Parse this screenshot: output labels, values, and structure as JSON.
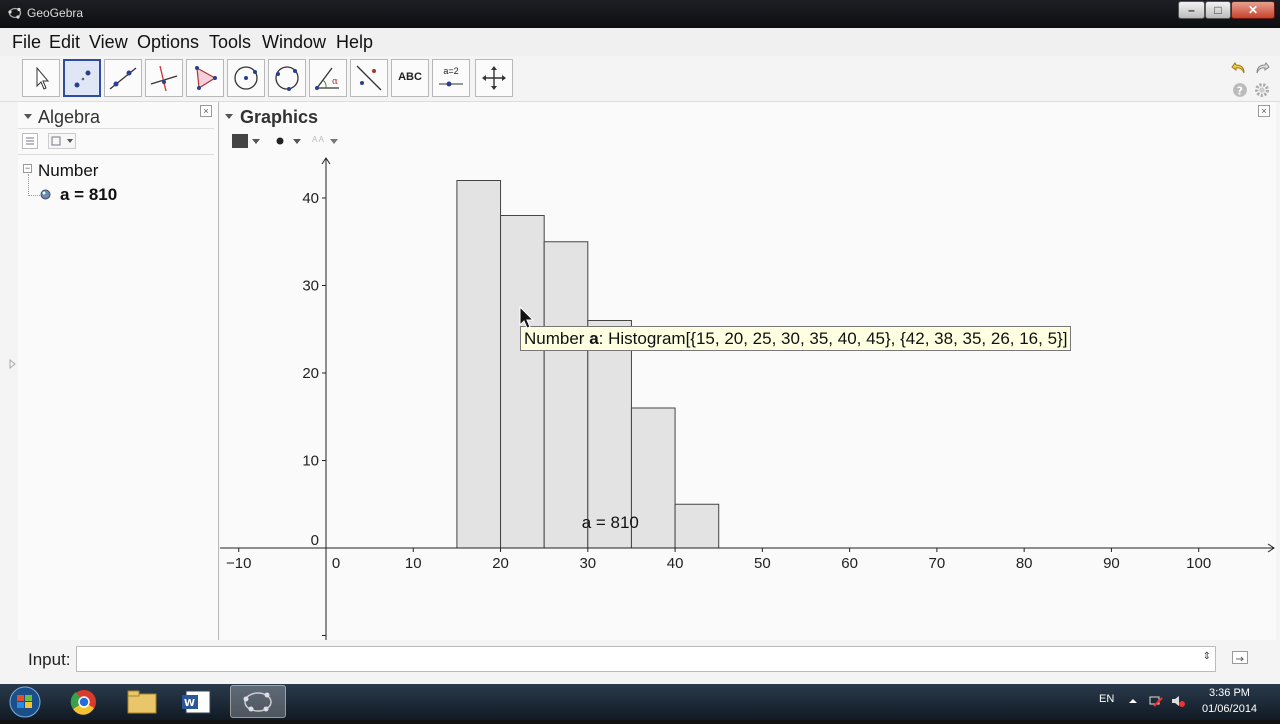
{
  "window": {
    "title": "GeoGebra"
  },
  "menu": [
    "File",
    "Edit",
    "View",
    "Options",
    "Tools",
    "Window",
    "Help"
  ],
  "toolbar": {
    "tools": [
      {
        "icon": "move-arrow-icon"
      },
      {
        "icon": "point-icon",
        "selected": true
      },
      {
        "icon": "line-icon"
      },
      {
        "icon": "perpendicular-line-icon"
      },
      {
        "icon": "polygon-icon"
      },
      {
        "icon": "circle-center-point-icon"
      },
      {
        "icon": "circle-three-points-icon"
      },
      {
        "icon": "angle-icon"
      },
      {
        "icon": "reflect-icon"
      },
      {
        "icon": "text-tool-icon",
        "label": "ABC"
      },
      {
        "icon": "slider-icon",
        "label": "a=2"
      },
      {
        "icon": "move-graphics-view-icon"
      }
    ]
  },
  "algebra": {
    "title": "Algebra",
    "group": "Number",
    "object": "a = 810"
  },
  "graphics": {
    "title": "Graphics",
    "label_in_view": "a = 810",
    "tooltip_prefix": "Number ",
    "tooltip_name": "a",
    "tooltip_rest": ": Histogram[{15, 20, 25, 30, 35, 40, 45}, {42, 38, 35, 26, 16, 5}]"
  },
  "input": {
    "label": "Input:",
    "value": ""
  },
  "taskbar": {
    "lang": "EN",
    "time": "3:36 PM",
    "date": "01/06/2014"
  },
  "colors": {
    "bar_fill": "#e3e3e3",
    "bar_stroke": "#444444",
    "tooltip_bg": "#ffffe1",
    "selected_tool_border": "#2f4d9f"
  },
  "chart_data": {
    "type": "bar",
    "subtype": "histogram",
    "class_boundaries": [
      15,
      20,
      25,
      30,
      35,
      40,
      45
    ],
    "values": [
      42,
      38,
      35,
      26,
      16,
      5
    ],
    "x_ticks": [
      -10,
      0,
      10,
      20,
      30,
      40,
      50,
      60,
      70,
      80,
      90,
      100
    ],
    "y_ticks": [
      0,
      10,
      20,
      30,
      40
    ],
    "xlim": [
      -12,
      108
    ],
    "ylim": [
      -10,
      45
    ],
    "grid": false
  }
}
